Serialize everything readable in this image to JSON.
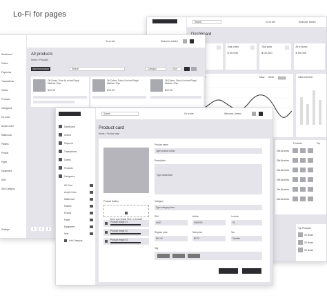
{
  "page_title": "Lo-Fi  for pages",
  "right_frame": {
    "search": "Search",
    "goto": "Go to site",
    "welcome": "Welcome, Admin!",
    "heading": "Dashboard",
    "stats": [
      {
        "label": "Total sales",
        "value": "$ 00,000"
      },
      {
        "label": "Total orders",
        "value": "$ 00,000"
      },
      {
        "label": "Total sales",
        "value": "$ 00,000"
      },
      {
        "label": "All in Stores",
        "value": "$ 00,000"
      }
    ],
    "performance": "Performance",
    "periods": [
      "Today",
      "Week",
      "Monthly"
    ],
    "visits": "Visits overview",
    "table_headers": [
      "Products",
      "Top"
    ],
    "top_products": "Top Products",
    "product_rows": [
      "Oil Brush",
      "Oil Brush",
      "Oil Brush"
    ],
    "row_item": "Oils Brushes"
  },
  "left_frame": {
    "heading": "All products",
    "breadcrumb": "Home > Products",
    "add_button": "Add new product",
    "search": "Search",
    "category": "Category",
    "sort": "Sort",
    "goto": "Go to site",
    "welcome": "Welcome, Admin!",
    "menu": [
      "Dashboard",
      "Orders",
      "Payments",
      "Transactions",
      "Clients",
      "Products",
      "Categories"
    ],
    "sub_menu": [
      "Oil Color",
      "Acrylic Color",
      "Watercolor",
      "Pastels",
      "Pencils",
      "Paper",
      "Equipment",
      "Sets",
      "Add Category"
    ],
    "settings": "Settings",
    "products": [
      {
        "name": "Oil Colors, Tube 44 ml set Royal Medium 12pc",
        "price": "$12.00"
      },
      {
        "name": "Oil Colors, Tube 44 ml set Royal Medium 12pc",
        "price": "$12.00"
      },
      {
        "name": "Oil Colors, Tube 44 ml set Royal Medium 12pc",
        "price": "$12.00"
      }
    ],
    "pager": [
      "1",
      "2",
      "3"
    ]
  },
  "front_frame": {
    "heading": "Product card",
    "breadcrumb": "Home > Product card",
    "search": "Search",
    "goto": "Go to site",
    "welcome": "Welcome, Admin!",
    "menu": [
      "Dashboard",
      "Orders",
      "Payment",
      "Transactions",
      "Clients",
      "Products",
      "Categories"
    ],
    "sub_menu": [
      "Oil Color",
      "Acrylic Color",
      "Watercolor",
      "Pastels",
      "Pencils",
      "Paper",
      "Equipment",
      "Sets",
      "Add Category"
    ],
    "gallery_label": "Product Gallery",
    "drop_text": "Drop your image here, or browse",
    "drop_hint": "jpeg, png are allowed",
    "uploads": [
      "Product image 01",
      "Product image 02",
      "Product image 03"
    ],
    "fields": {
      "name_label": "Product name",
      "name_value": "Type product name",
      "desc_label": "Description",
      "desc_value": "Type description",
      "cat_label": "Category",
      "cat_value": "Type category here",
      "sku_label": "SKU",
      "sku_value": "#A00",
      "article_label": "Article",
      "article_value": "#000000",
      "stock_label": "In stock",
      "stock_value": "00",
      "reg_label": "Regular price",
      "reg_value": "$10.00",
      "sale_label": "Sale price",
      "sale_value": "$9.70",
      "tax_label": "Tax",
      "tax_value": "Taxable",
      "tag_label": "Tag"
    }
  }
}
